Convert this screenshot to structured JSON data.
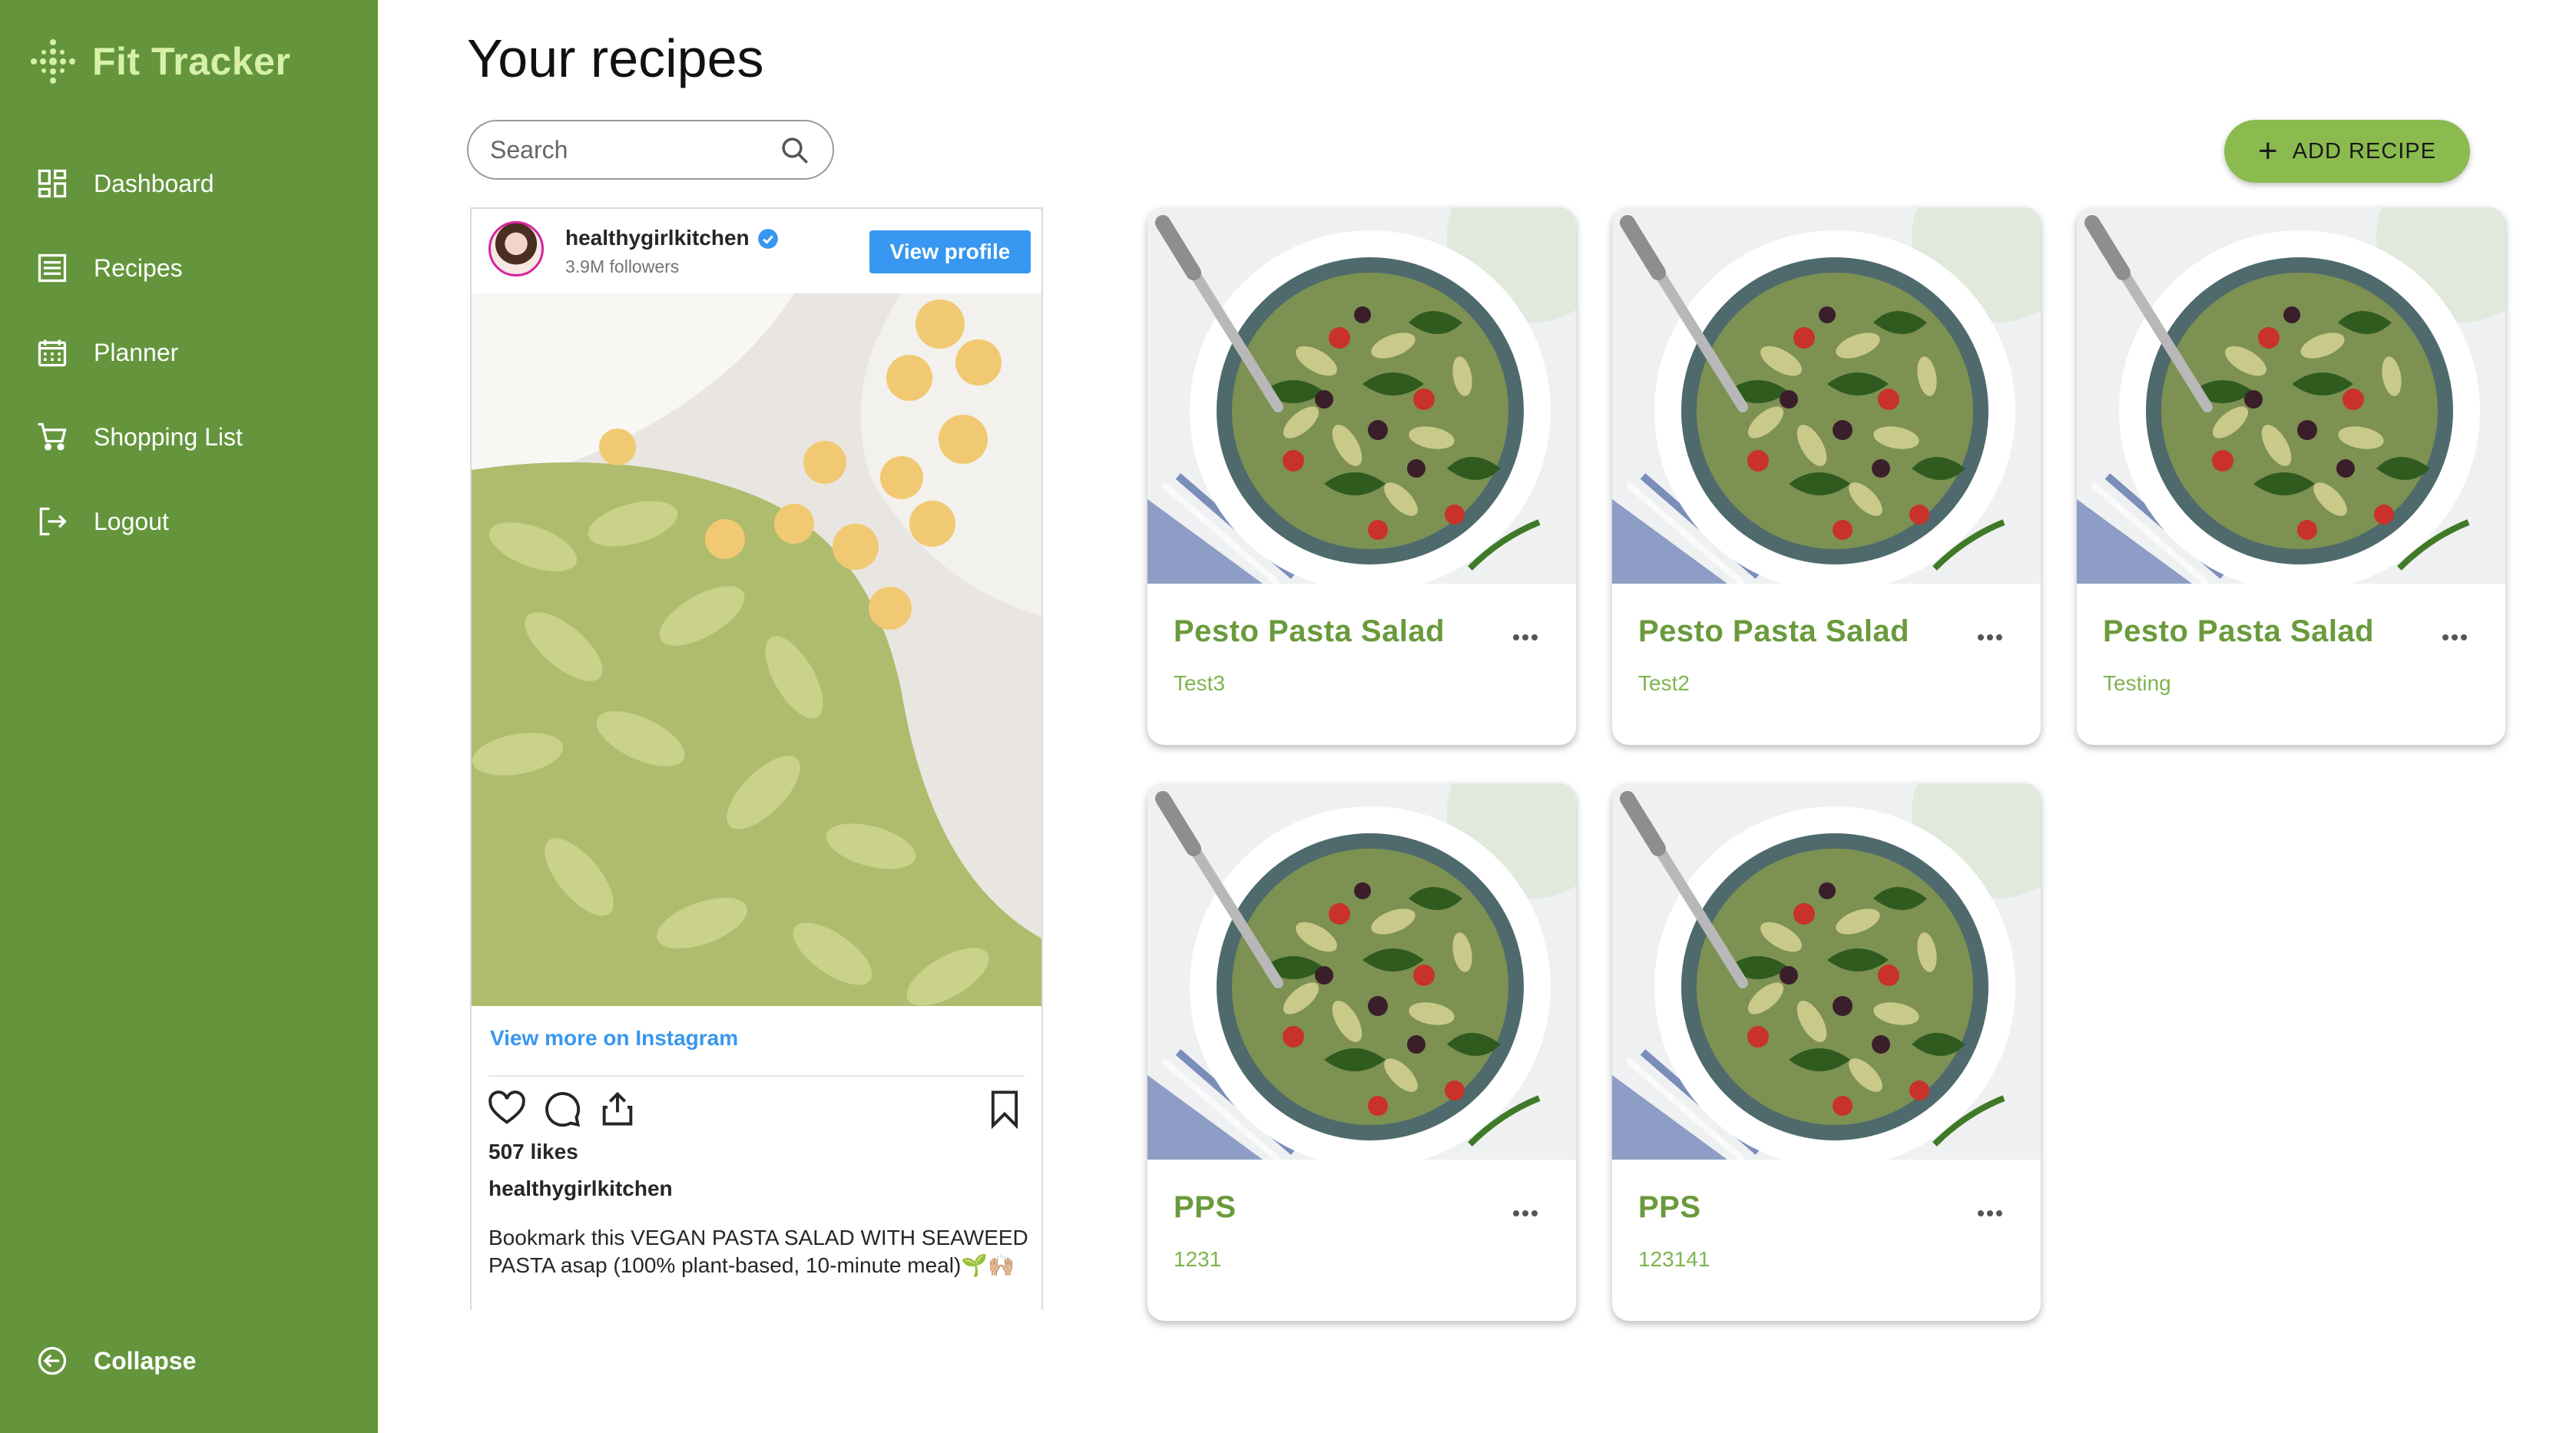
{
  "sidebar": {
    "brand": "Fit Tracker",
    "items": [
      {
        "label": "Dashboard",
        "icon": "dashboard-icon"
      },
      {
        "label": "Recipes",
        "icon": "list-icon"
      },
      {
        "label": "Planner",
        "icon": "calendar-icon"
      },
      {
        "label": "Shopping List",
        "icon": "cart-icon"
      },
      {
        "label": "Logout",
        "icon": "logout-icon"
      }
    ],
    "collapse_label": "Collapse"
  },
  "header": {
    "title": "Your recipes",
    "search_placeholder": "Search",
    "add_label": "ADD RECIPE"
  },
  "instagram": {
    "username": "healthygirlkitchen",
    "followers": "3.9M followers",
    "view_profile": "View profile",
    "view_more": "View more on Instagram",
    "likes": "507 likes",
    "author": "healthygirlkitchen",
    "caption": "Bookmark this VEGAN PASTA SALAD WITH SEAWEED PASTA asap (100% plant-based, 10-minute meal)🌱🙌🏼"
  },
  "recipes": [
    {
      "title": "Pesto Pasta Salad",
      "subtitle": "Test3"
    },
    {
      "title": "Pesto Pasta Salad",
      "subtitle": "Test2"
    },
    {
      "title": "Pesto Pasta Salad",
      "subtitle": "Testing"
    },
    {
      "title": "PPS",
      "subtitle": "1231"
    },
    {
      "title": "PPS",
      "subtitle": "123141"
    }
  ],
  "colors": {
    "sidebar": "#64953c",
    "brand": "#d7f0a9",
    "accent": "#8bbb4f",
    "card_title": "#6a9a3c",
    "instagram_blue": "#3897f0"
  }
}
